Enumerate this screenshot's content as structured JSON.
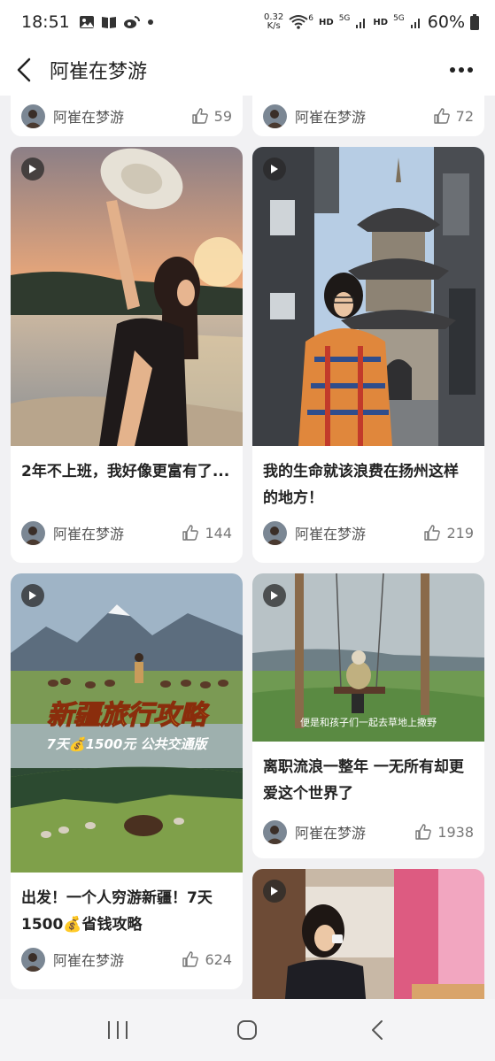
{
  "status_bar": {
    "time": "18:51",
    "net_speed_top": "0.32",
    "net_speed_unit": "K/s",
    "wifi_sub": "6",
    "hd1": "HD",
    "sig1": "5G",
    "hd2": "HD",
    "sig2": "5G",
    "battery": "60%"
  },
  "header": {
    "title": "阿崔在梦游"
  },
  "author": "阿崔在梦游",
  "top_row": [
    {
      "author": "阿崔在梦游",
      "likes": "59"
    },
    {
      "author": "阿崔在梦游",
      "likes": "72"
    }
  ],
  "cards": [
    {
      "title": "2年不上班，我好像更富有了...",
      "author": "阿崔在梦游",
      "likes": "144"
    },
    {
      "title": "我的生命就该浪费在扬州这样的地方！",
      "author": "阿崔在梦游",
      "likes": "219"
    },
    {
      "title": "出发！一个人穷游新疆！7天1500💰省钱攻略",
      "author": "阿崔在梦游",
      "likes": "624",
      "cover_title": "新疆旅行攻略",
      "cover_subtitle": "7天💰1500元 公共交通版"
    },
    {
      "title": "离职流浪一整年 一无所有却更爱这个世界了",
      "author": "阿崔在梦游",
      "likes": "1938",
      "cover_caption": "便是和孩子们一起去草地上撒野"
    }
  ],
  "icons": {
    "back": "chevron-left-icon",
    "more": "more-dots-icon",
    "like": "thumbs-up-icon",
    "play": "play-icon"
  }
}
